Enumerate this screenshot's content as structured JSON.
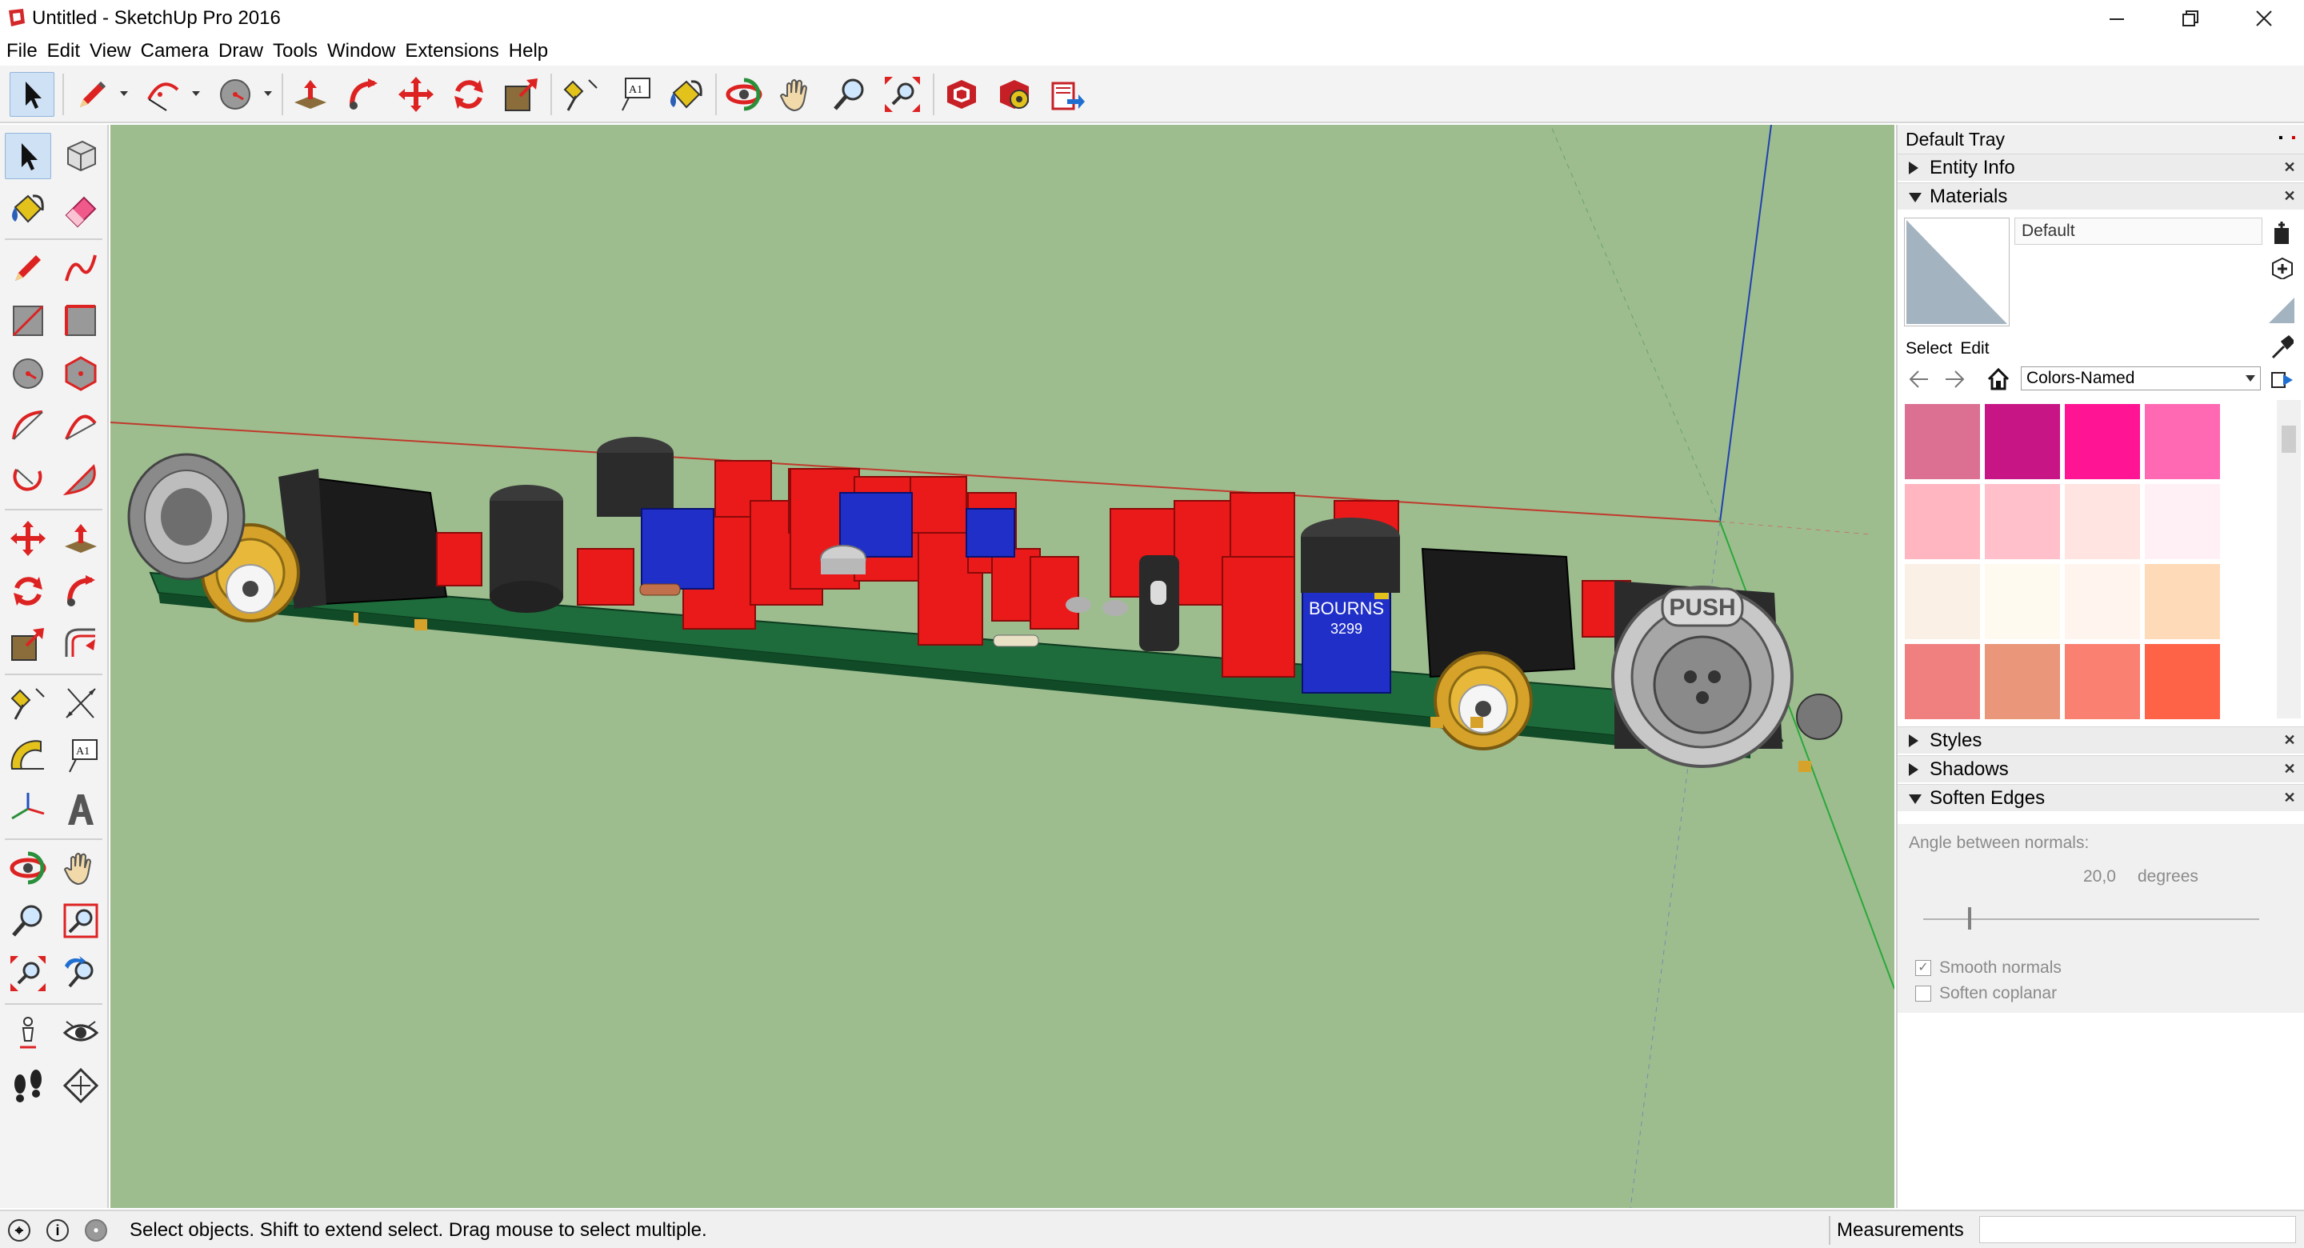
{
  "window": {
    "title": "Untitled - SketchUp Pro 2016",
    "controls": [
      "minimize",
      "restore",
      "close"
    ]
  },
  "menu": [
    "File",
    "Edit",
    "View",
    "Camera",
    "Draw",
    "Tools",
    "Window",
    "Extensions",
    "Help"
  ],
  "toolbar_icons": [
    "select-arrow-icon",
    "pencil-line-icon",
    "arc-icon",
    "circle-icon",
    "push-pull-icon",
    "follow-me-icon",
    "move-icon",
    "rotate-icon",
    "scale-icon",
    "tape-measure-icon",
    "text-icon",
    "paint-bucket-icon",
    "orbit-icon",
    "pan-icon",
    "zoom-icon",
    "zoom-extents-icon",
    "3d-warehouse-icon",
    "extension-warehouse-icon",
    "send-to-layout-icon"
  ],
  "tray": {
    "title": "Default Tray",
    "panels": {
      "entity_info": "Entity Info",
      "materials": "Materials",
      "styles": "Styles",
      "shadows": "Shadows",
      "soften_edges": "Soften Edges"
    },
    "materials": {
      "current_name": "Default",
      "tab_select": "Select",
      "tab_edit": "Edit",
      "library": "Colors-Named",
      "swatches": [
        [
          "#db7093",
          "#c71585",
          "#ff1493",
          "#ff69b4"
        ],
        [
          "#ffb6c1",
          "#ffc0cb",
          "#ffe4e1",
          "#fff0f5"
        ],
        [
          "#faf0e6",
          "#fffaf0",
          "#fff5ee",
          "#ffdab9"
        ],
        [
          "#f08080",
          "#e9967a",
          "#fa8072",
          "#ff6347"
        ]
      ]
    },
    "soften": {
      "angle_label": "Angle between normals:",
      "angle_value": "20,0",
      "angle_unit": "degrees",
      "smooth_label": "Smooth normals",
      "smooth_checked": true,
      "coplanar_label": "Soften coplanar",
      "coplanar_checked": false
    }
  },
  "viewport": {
    "background": "#9dbd8f",
    "labels": {
      "trimmer_brand": "BOURNS",
      "trimmer_model": "3299",
      "xlr_push": "PUSH"
    }
  },
  "status": {
    "message": "Select objects. Shift to extend select. Drag mouse to select multiple.",
    "measurements_label": "Measurements",
    "measurements_value": ""
  }
}
